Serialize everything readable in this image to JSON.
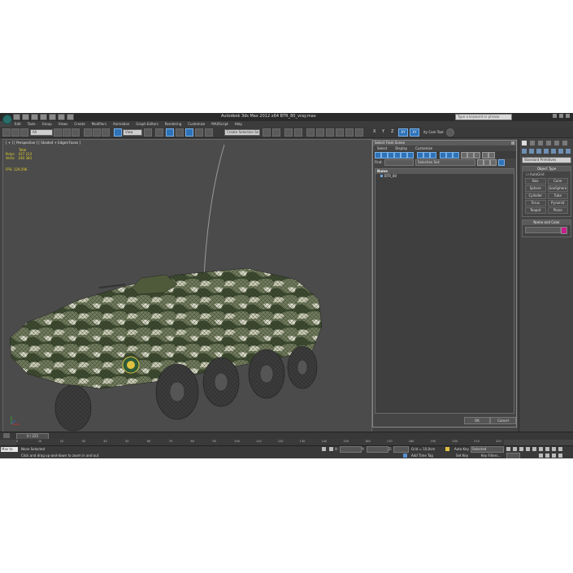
{
  "app": {
    "title": "Autodesk 3ds Max  2012 x64     BTR_80_vray.max",
    "search_placeholder": "Type a keyword or phrase"
  },
  "menu": [
    "Edit",
    "Tools",
    "Group",
    "Views",
    "Create",
    "Modifiers",
    "Animation",
    "Graph Editors",
    "Rendering",
    "Customize",
    "MAXScript",
    "Help"
  ],
  "toolbar": {
    "filter_dropdown": "All",
    "view_dropdown": "View",
    "selection_set": "Create Selection Se",
    "axis_x": "X",
    "axis_y": "Y",
    "axis_z": "Z",
    "axis_xy": "XY",
    "axis_xy2": "XY",
    "custom_tools": "ity Cam Tool"
  },
  "viewport": {
    "label": "[ + ] [ Perspective ] [ Shaded + Edged Faces ]",
    "stats_header": "Total",
    "polys_label": "Polys:",
    "polys_value": "437 213",
    "verts_label": "Verts:",
    "verts_value": "240 383",
    "fps_label": "FPS:",
    "fps_value": "129,596"
  },
  "scene_explorer": {
    "title": "Select From Scene",
    "menu": [
      "Select",
      "Display",
      "Customize"
    ],
    "find_label": "Find:",
    "selection_set_label": "Selection Set:",
    "column_name": "Name",
    "items": [
      "BTR_80"
    ],
    "ok": "OK",
    "cancel": "Cancel"
  },
  "command_panel": {
    "category_dropdown": "Standard Primitives",
    "object_type_header": "Object Type",
    "autogrid": "AutoGrid",
    "buttons": [
      "Box",
      "Cone",
      "Sphere",
      "GeoSphere",
      "Cylinder",
      "Tube",
      "Torus",
      "Pyramid",
      "Teapot",
      "Plane"
    ],
    "name_color_header": "Name and Color",
    "object_color": "#c71f8b"
  },
  "timeline": {
    "slider": "0 / 225",
    "ticks": [
      "0",
      "10",
      "20",
      "30",
      "40",
      "50",
      "60",
      "70",
      "80",
      "90",
      "100",
      "110",
      "120",
      "130",
      "140",
      "150",
      "160",
      "170",
      "180",
      "190",
      "200",
      "210",
      "220"
    ]
  },
  "status": {
    "max_script": "Max to",
    "selection": "None Selected",
    "prompt": "Click and drag up-and-down to zoom in and out",
    "x_label": "X:",
    "y_label": "Y:",
    "z_label": "Z:",
    "grid": "Grid = 10,0cm",
    "auto_key": "Auto Key",
    "auto_key_value": "Selected",
    "set_key": "Set Key",
    "key_filters": "Key Filters...",
    "add_time_tag": "Add Time Tag"
  }
}
